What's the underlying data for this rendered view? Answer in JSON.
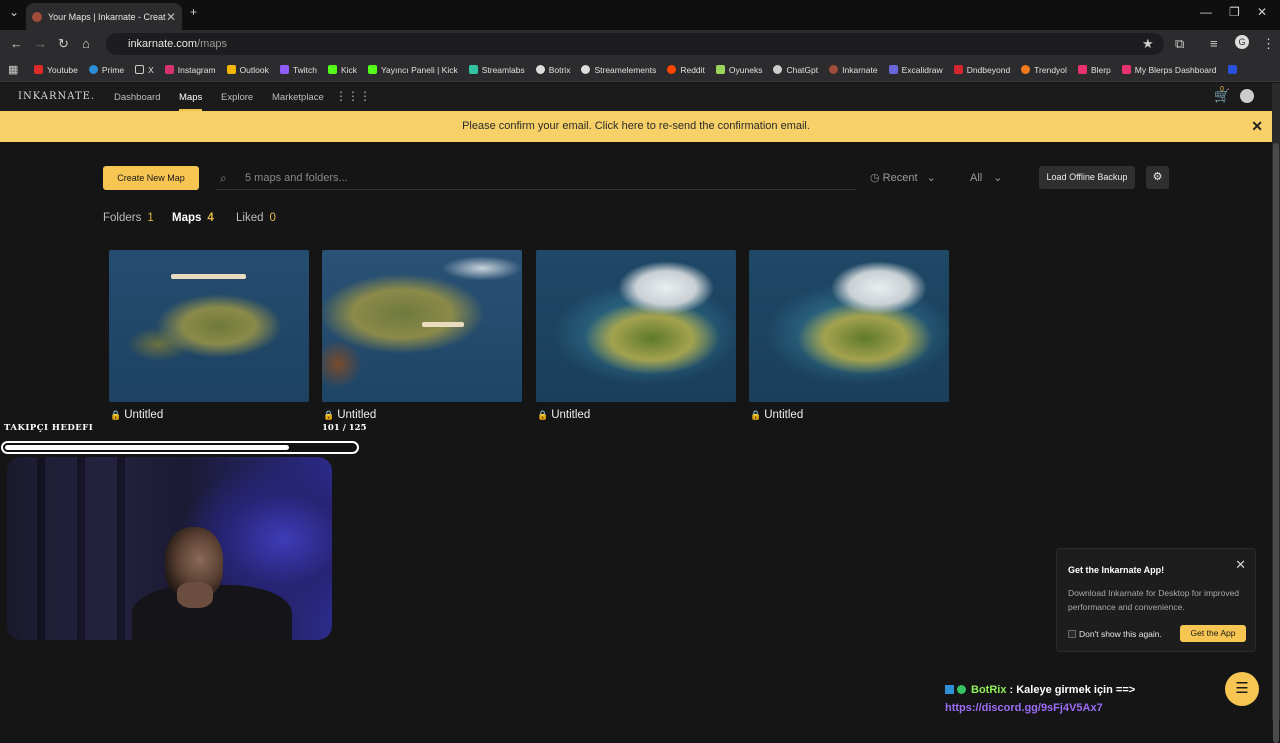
{
  "browser": {
    "tab_title": "Your Maps | Inkarnate - Create",
    "url_host": "inkarnate.com",
    "url_path": "/maps",
    "bookmarks": [
      {
        "label": "Youtube",
        "color": "#e02b2b"
      },
      {
        "label": "Prime",
        "color": "#2a8fd8"
      },
      {
        "label": "X",
        "color": "#cccccc"
      },
      {
        "label": "Instagram",
        "color": "#d6336c"
      },
      {
        "label": "Outlook",
        "color": "#f2b705"
      },
      {
        "label": "Twitch",
        "color": "#8e5cf7"
      },
      {
        "label": "Kick",
        "color": "#53fc18"
      },
      {
        "label": "Yayıncı Paneli | Kick",
        "color": "#53fc18"
      },
      {
        "label": "Streamlabs",
        "color": "#31c3a2"
      },
      {
        "label": "Botrix",
        "color": "#dddddd"
      },
      {
        "label": "Streamelements",
        "color": "#dddddd"
      },
      {
        "label": "Reddit",
        "color": "#ff4500"
      },
      {
        "label": "Oyuneks",
        "color": "#9bd45a"
      },
      {
        "label": "ChatGpt",
        "color": "#cccccc"
      },
      {
        "label": "Inkarnate",
        "color": "#a04c3a"
      },
      {
        "label": "Excalidraw",
        "color": "#6965db"
      },
      {
        "label": "Dndbeyond",
        "color": "#d4262e"
      },
      {
        "label": "Trendyol",
        "color": "#f27a1a"
      },
      {
        "label": "Blerp",
        "color": "#e8326d"
      },
      {
        "label": "My Blerps Dashboard",
        "color": "#e8326d"
      }
    ]
  },
  "site": {
    "logo": "INKARNATE.",
    "nav": [
      "Dashboard",
      "Maps",
      "Explore",
      "Marketplace"
    ],
    "cart_count": "0",
    "banner": "Please confirm your email. Click here to re-send the confirmation email."
  },
  "toolbar": {
    "create_label": "Create New Map",
    "search_placeholder": "5 maps and folders...",
    "sort_label": "Recent",
    "filter_label": "All",
    "backup_label": "Load Offline Backup"
  },
  "filters": [
    {
      "label": "Folders",
      "count": "1"
    },
    {
      "label": "Maps",
      "count": "4"
    },
    {
      "label": "Liked",
      "count": "0"
    }
  ],
  "maps": [
    {
      "title": "Untitled"
    },
    {
      "title": "Untitled"
    },
    {
      "title": "Untitled"
    },
    {
      "title": "Untitled"
    }
  ],
  "overlay": {
    "goal_title": "TAKIPÇI HEDEFI",
    "goal_count": "101 / 125",
    "goal_progress": 0.81,
    "bot_name": "BotRix",
    "bot_message": " : Kaleye girmek için ==>",
    "bot_link": "https://discord.gg/9sFj4V5Ax7"
  },
  "popup": {
    "title": "Get the Inkarnate App!",
    "description": "Download Inkarnate for Desktop for improved performance and convenience.",
    "checkbox_label": "Don't show this again.",
    "button_label": "Get the App"
  }
}
